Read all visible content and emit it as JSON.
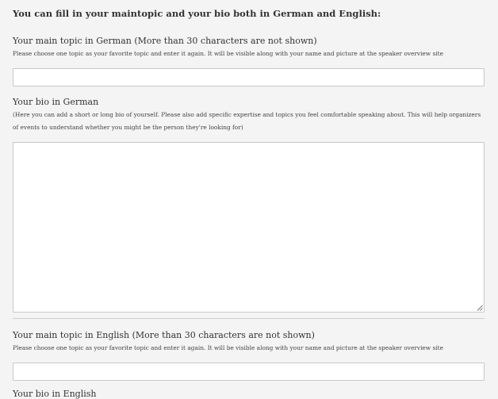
{
  "heading": "You can fill in your maintopic and your bio both in German and English:",
  "german": {
    "topic_label": "Your main topic in German (More than 30 characters are not shown)",
    "topic_help": "Please choose one topic as your favorite topic and enter it again. It will be visible along with your name and picture at the speaker overview site",
    "topic_value": "",
    "bio_label": "Your bio in German",
    "bio_help": "(Here you can add a short or long bio of yourself. Please also add specific expertise and topics you feel comfortable speaking about. This will help organizers of events to understand whether you might be the person they're looking for)",
    "bio_value": ""
  },
  "english": {
    "topic_label": "Your main topic in English (More than 30 characters are not shown)",
    "topic_help": "Please choose one topic as your favorite topic and enter it again. It will be visible along with your name and picture at the speaker overview site",
    "topic_value": "",
    "bio_label": "Your bio in English"
  }
}
